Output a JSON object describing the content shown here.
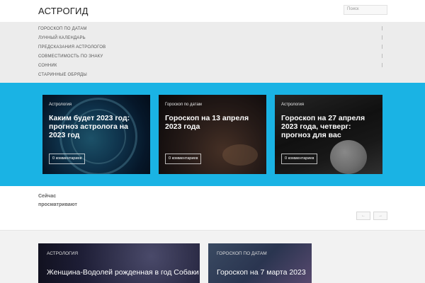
{
  "site": {
    "title": "АСТРОГИД"
  },
  "search": {
    "placeholder": "Поиск"
  },
  "nav": {
    "items": [
      {
        "label": "ГОРОСКОП ПО ДАТАМ"
      },
      {
        "label": "ЛУННЫЙ КАЛЕНДАРЬ"
      },
      {
        "label": "ПРЕДСКАЗАНИЯ АСТРОЛОГОВ"
      },
      {
        "label": "СОВМЕСТИМОСТЬ ПО ЗНАКУ"
      },
      {
        "label": "СОННИК"
      },
      {
        "label": "СТАРИННЫЕ ОБРЯДЫ"
      }
    ]
  },
  "featured": {
    "accent_color": "#1ab3e4",
    "cards": [
      {
        "category": "Астрология",
        "title": "Каким будет 2023 год: прогноз астролога на 2023 год",
        "comments": "0 комментариев"
      },
      {
        "category": "Гороскоп по датам",
        "title": "Гороскоп на 13 апреля 2023 года",
        "comments": "0 комментариев"
      },
      {
        "category": "Астрология",
        "title": "Гороскоп на 27 апреля 2023 года, четверг: прогноз для вас",
        "comments": "0 комментариев"
      }
    ]
  },
  "viewing": {
    "title": "Сейчас просматривают",
    "prev_label": "←",
    "next_label": "→"
  },
  "lower": {
    "cards": [
      {
        "category": "АСТРОЛОГИЯ",
        "title": "Женщина-Водолей рожденная в год Собаки"
      },
      {
        "category": "ГОРОСКОП ПО ДАТАМ",
        "title": "Гороскоп на 7 марта 2023"
      }
    ]
  }
}
